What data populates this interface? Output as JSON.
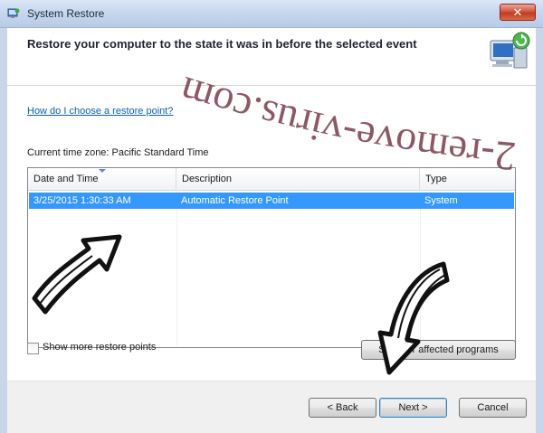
{
  "window": {
    "title": "System Restore",
    "close_label": "✕"
  },
  "header": {
    "text": "Restore your computer to the state it was in before the selected event"
  },
  "help_link": "How do I choose a restore point?",
  "timezone_label": "Current time zone: Pacific Standard Time",
  "table": {
    "columns": [
      "Date and Time",
      "Description",
      "Type"
    ],
    "rows": [
      {
        "date": "3/25/2015 1:30:33 AM",
        "description": "Automatic Restore Point",
        "type": "System",
        "selected": true
      }
    ]
  },
  "checkbox": {
    "label": "Show more restore points",
    "checked": false
  },
  "buttons": {
    "affected_programs": "Scan for affected programs",
    "back": "< Back",
    "next": "Next >",
    "cancel": "Cancel"
  },
  "watermark": "2-remove-virus.com",
  "colors": {
    "selection": "#3399ff",
    "link": "#0b5fb8",
    "watermark": "#7a3a4a"
  }
}
